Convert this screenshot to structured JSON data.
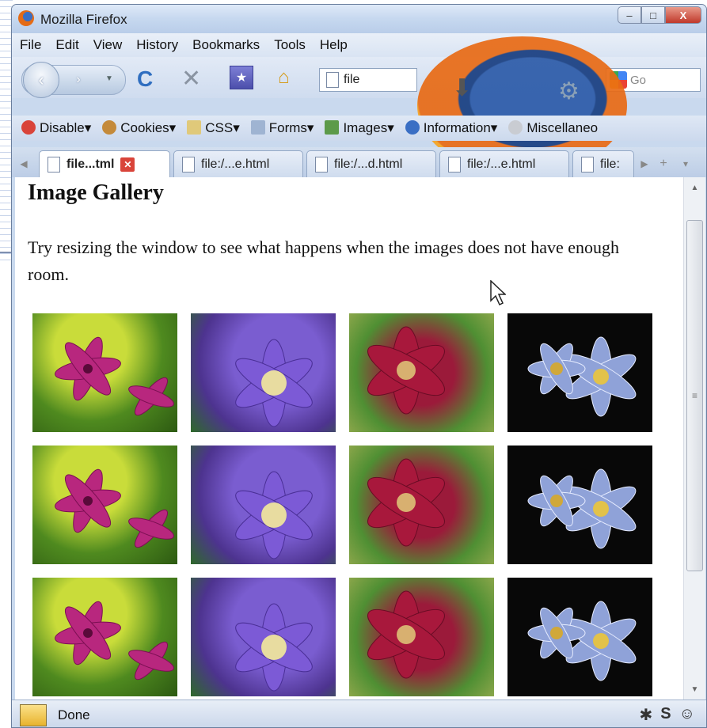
{
  "window": {
    "title": "Mozilla Firefox",
    "controls": {
      "minimize": "–",
      "maximize": "□",
      "close": "X"
    }
  },
  "menu": {
    "items": [
      "File",
      "Edit",
      "View",
      "History",
      "Bookmarks",
      "Tools",
      "Help"
    ]
  },
  "navigation": {
    "back_glyph": "‹",
    "forward_glyph": "›",
    "reload_glyph": "C",
    "stop_glyph": "✕",
    "bookmark_glyph": "★",
    "home_glyph": "⌂",
    "url_value": "file",
    "search_placeholder": "Go"
  },
  "webdev_toolbar": {
    "items": [
      "Disable",
      "Cookies",
      "CSS",
      "Forms",
      "Images",
      "Information",
      "Miscellaneo"
    ]
  },
  "tabs": [
    {
      "label": "file...tml",
      "active": true
    },
    {
      "label": "file:/...e.html",
      "active": false
    },
    {
      "label": "file:/...d.html",
      "active": false
    },
    {
      "label": "file:/...e.html",
      "active": false
    },
    {
      "label": "file:",
      "active": false
    }
  ],
  "page": {
    "heading": "Image Gallery",
    "paragraph": "Try resizing the window to see what happens when the images does not have enough room."
  },
  "gallery": {
    "rows": 3,
    "thumbnails": [
      "pink-lily",
      "purple-clematis",
      "red-clematis",
      "blue-clematis"
    ]
  },
  "status": {
    "text": "Done",
    "icons": [
      "bug-icon",
      "s-icon",
      "smiley-icon"
    ]
  },
  "colors": {
    "chrome_blue": "#c9d9ee",
    "close_red": "#c0392b",
    "firefox_orange": "#e86a14"
  }
}
